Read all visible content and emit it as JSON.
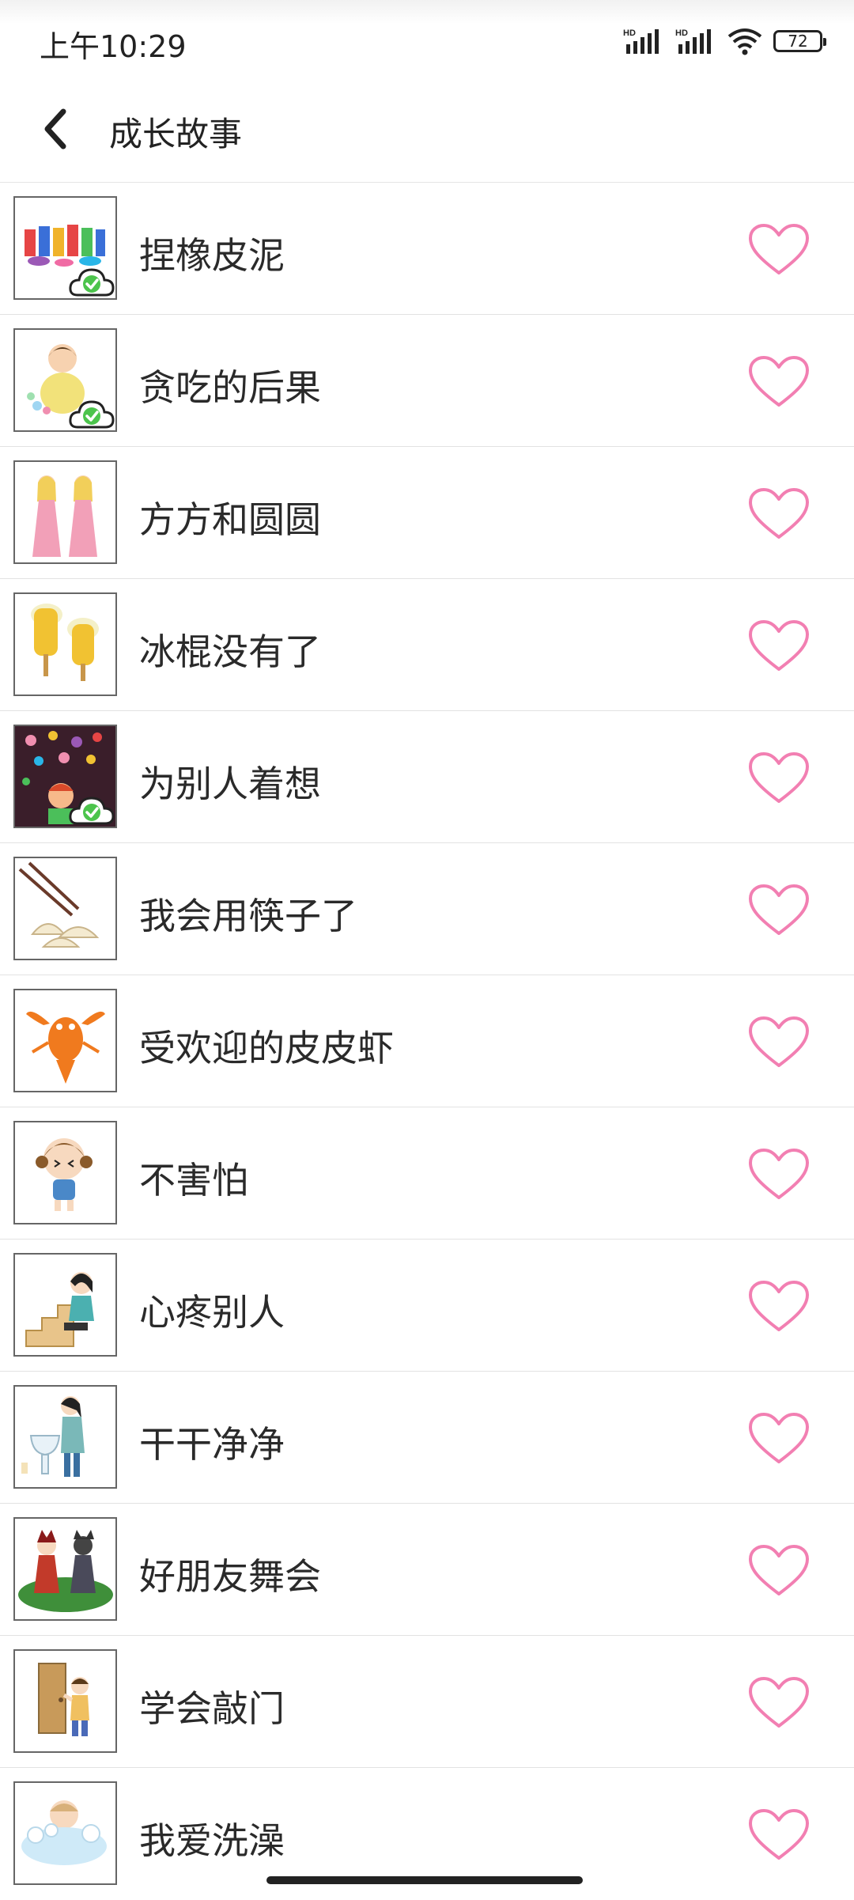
{
  "status_bar": {
    "time": "上午10:29",
    "battery": "72",
    "signal_label": "HD"
  },
  "header": {
    "title": "成长故事"
  },
  "colors": {
    "heart": "#f27fb2",
    "cloud_check": "#4cc44c"
  },
  "stories": [
    {
      "title": "捏橡皮泥",
      "cloud_synced": true
    },
    {
      "title": "贪吃的后果",
      "cloud_synced": true
    },
    {
      "title": "方方和圆圆",
      "cloud_synced": false
    },
    {
      "title": "冰棍没有了",
      "cloud_synced": false
    },
    {
      "title": "为别人着想",
      "cloud_synced": true
    },
    {
      "title": "我会用筷子了",
      "cloud_synced": false
    },
    {
      "title": "受欢迎的皮皮虾",
      "cloud_synced": false
    },
    {
      "title": "不害怕",
      "cloud_synced": false
    },
    {
      "title": "心疼别人",
      "cloud_synced": false
    },
    {
      "title": "干干净净",
      "cloud_synced": false
    },
    {
      "title": "好朋友舞会",
      "cloud_synced": false
    },
    {
      "title": "学会敲门",
      "cloud_synced": false
    },
    {
      "title": "我爱洗澡",
      "cloud_synced": false
    }
  ]
}
